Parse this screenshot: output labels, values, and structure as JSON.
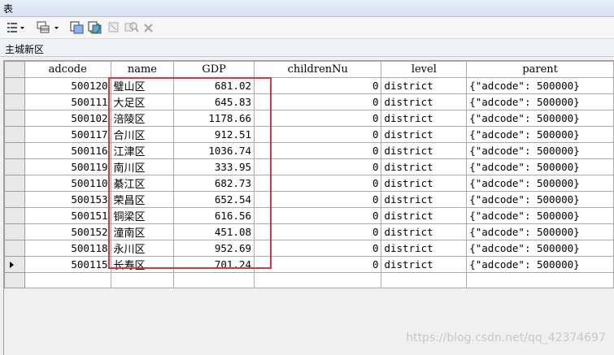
{
  "window": {
    "title": "表"
  },
  "toolbar": {
    "items": [
      {
        "name": "table-options-icon"
      },
      {
        "name": "related-tables-icon"
      },
      {
        "name": "select-by-attributes-icon"
      },
      {
        "name": "switch-selection-icon"
      },
      {
        "name": "clear-selection-icon"
      },
      {
        "name": "zoom-to-selected-icon"
      },
      {
        "name": "delete-selected-icon"
      }
    ]
  },
  "tab": {
    "name": "主城新区"
  },
  "table": {
    "columns": [
      "adcode",
      "name",
      "GDP",
      "childrenNu",
      "level",
      "parent"
    ],
    "rows": [
      {
        "adcode": "500120",
        "name": "璧山区",
        "gdp": "681.02",
        "children": "0",
        "level": "district",
        "parent": "{\"adcode\": 500000}"
      },
      {
        "adcode": "500111",
        "name": "大足区",
        "gdp": "645.83",
        "children": "0",
        "level": "district",
        "parent": "{\"adcode\": 500000}"
      },
      {
        "adcode": "500102",
        "name": "涪陵区",
        "gdp": "1178.66",
        "children": "0",
        "level": "district",
        "parent": "{\"adcode\": 500000}"
      },
      {
        "adcode": "500117",
        "name": "合川区",
        "gdp": "912.51",
        "children": "0",
        "level": "district",
        "parent": "{\"adcode\": 500000}"
      },
      {
        "adcode": "500116",
        "name": "江津区",
        "gdp": "1036.74",
        "children": "0",
        "level": "district",
        "parent": "{\"adcode\": 500000}"
      },
      {
        "adcode": "500119",
        "name": "南川区",
        "gdp": "333.95",
        "children": "0",
        "level": "district",
        "parent": "{\"adcode\": 500000}"
      },
      {
        "adcode": "500110",
        "name": "綦江区",
        "gdp": "682.73",
        "children": "0",
        "level": "district",
        "parent": "{\"adcode\": 500000}"
      },
      {
        "adcode": "500153",
        "name": "荣昌区",
        "gdp": "652.54",
        "children": "0",
        "level": "district",
        "parent": "{\"adcode\": 500000}"
      },
      {
        "adcode": "500151",
        "name": "铜梁区",
        "gdp": "616.56",
        "children": "0",
        "level": "district",
        "parent": "{\"adcode\": 500000}"
      },
      {
        "adcode": "500152",
        "name": "潼南区",
        "gdp": "451.08",
        "children": "0",
        "level": "district",
        "parent": "{\"adcode\": 500000}"
      },
      {
        "adcode": "500118",
        "name": "永川区",
        "gdp": "952.69",
        "children": "0",
        "level": "district",
        "parent": "{\"adcode\": 500000}"
      },
      {
        "adcode": "500115",
        "name": "长寿区",
        "gdp": "701.24",
        "children": "0",
        "level": "district",
        "parent": "{\"adcode\": 500000}"
      }
    ]
  },
  "watermark": "https://blog.csdn.net/qq_42374697"
}
